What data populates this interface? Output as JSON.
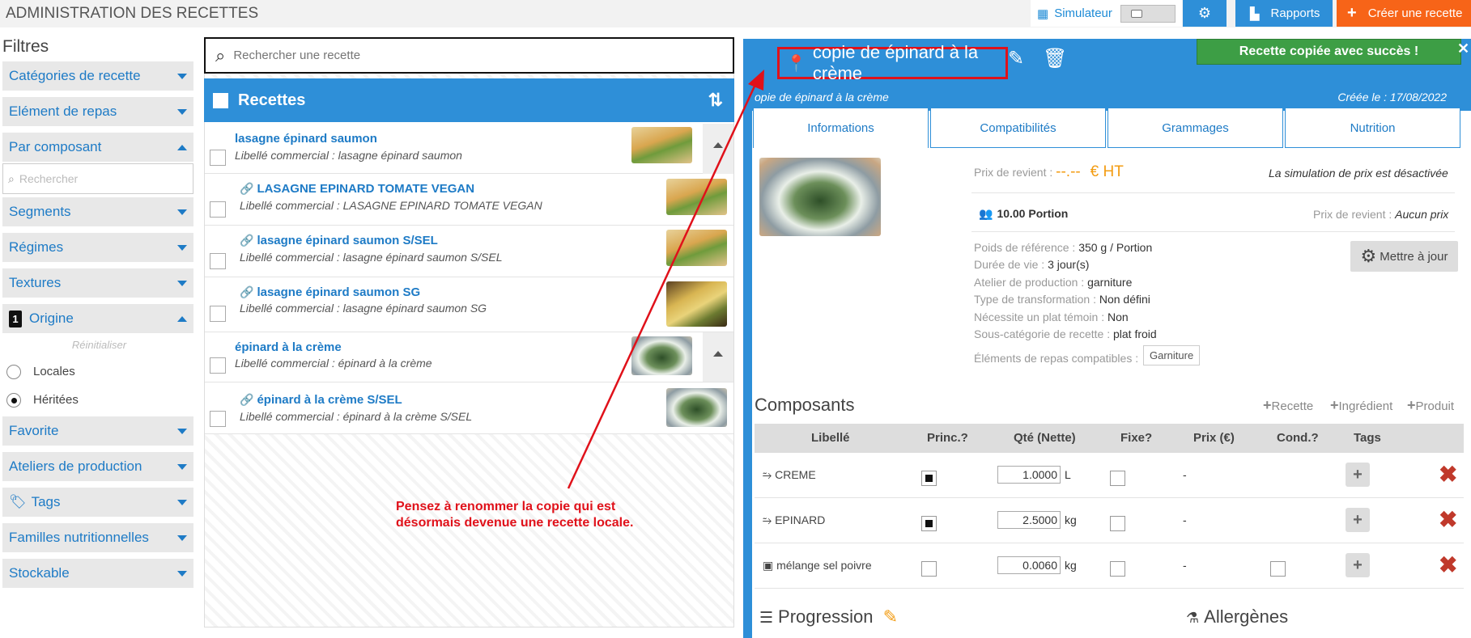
{
  "app": {
    "title": "ADMINISTRATION DES RECETTES"
  },
  "toolbar": {
    "simulator_label": "Simulateur",
    "reports_label": "Rapports",
    "create_label": "Créer une recette"
  },
  "filters": {
    "title": "Filtres",
    "categories": "Catégories de recette",
    "meal_element": "Elément de repas",
    "by_component": "Par composant",
    "component_search_placeholder": "Rechercher",
    "segments": "Segments",
    "diets": "Régimes",
    "textures": "Textures",
    "origin_badge": "1",
    "origin": "Origine",
    "reset": "Réinitialiser",
    "origin_options": [
      "Locales",
      "Héritées"
    ],
    "origin_selected": "Héritées",
    "favorite": "Favorite",
    "workshops": "Ateliers de production",
    "tags": "Tags",
    "nutrition_families": "Familles nutritionnelles",
    "storable": "Stockable"
  },
  "list": {
    "search_placeholder": "Rechercher une recette",
    "header": "Recettes",
    "items": [
      {
        "name": "lasagne épinard saumon",
        "sub": "Libellé commercial : lasagne épinard saumon",
        "linked": false
      },
      {
        "name": "LASAGNE EPINARD TOMATE VEGAN",
        "sub": "Libellé commercial : LASAGNE EPINARD TOMATE VEGAN",
        "linked": true
      },
      {
        "name": "lasagne épinard saumon S/SEL",
        "sub": "Libellé commercial : lasagne épinard saumon S/SEL",
        "linked": true
      },
      {
        "name": "lasagne épinard saumon SG",
        "sub": "Libellé commercial : lasagne épinard saumon SG",
        "linked": true
      },
      {
        "name": "épinard à la crème",
        "sub": "Libellé commercial : épinard à la crème",
        "linked": false
      },
      {
        "name": "épinard à la crème S/SEL",
        "sub": "Libellé commercial : épinard à la crème S/SEL",
        "linked": true
      }
    ]
  },
  "annotation": {
    "line1": "Pensez à renommer la copie qui est",
    "line2": "désormais devenue une recette locale."
  },
  "detail": {
    "title": "copie de épinard à la crème",
    "subtitle": "opie de épinard à la crème",
    "created": "Créée le : 17/08/2022",
    "toast": "Recette copiée avec succès !",
    "tabs": [
      "Informations",
      "Compatibilités",
      "Grammages",
      "Nutrition"
    ],
    "cost_label": "Prix de revient :",
    "cost_value": "--.--",
    "cost_unit": "€ HT",
    "simulation_note": "La simulation de prix est désactivée",
    "portion": "10.00 Portion",
    "cost2_label": "Prix de revient :",
    "cost2_value": "Aucun prix",
    "update_button": "Mettre à jour",
    "props": [
      {
        "label": "Poids de référence :",
        "value": "350 g / Portion"
      },
      {
        "label": "Durée de vie :",
        "value": "3 jour(s)"
      },
      {
        "label": "Atelier de production :",
        "value": "garniture"
      },
      {
        "label": "Type de transformation :",
        "value": "Non défini"
      },
      {
        "label": "Nécessite un plat témoin :",
        "value": "Non"
      },
      {
        "label": "Sous-catégorie de recette :",
        "value": "plat froid"
      }
    ],
    "compat_label": "Éléments de repas compatibles :",
    "compat_value": "Garniture",
    "components_title": "Composants",
    "add_recipe": "Recette",
    "add_ingredient": "Ingrédient",
    "add_product": "Produit",
    "columns": [
      "Libellé",
      "Princ.?",
      "Qté (Nette)",
      "Fixe?",
      "Prix (€)",
      "Cond.?",
      "Tags"
    ],
    "rows": [
      {
        "name": "CREME",
        "main": true,
        "qty": "1.0000",
        "unit": "L",
        "price": "-"
      },
      {
        "name": "EPINARD",
        "main": true,
        "qty": "2.5000",
        "unit": "kg",
        "price": "-"
      },
      {
        "name": "mélange sel poivre",
        "main": false,
        "qty": "0.0060",
        "unit": "kg",
        "price": "-"
      }
    ],
    "progression": "Progression",
    "allergens": "Allergènes"
  }
}
